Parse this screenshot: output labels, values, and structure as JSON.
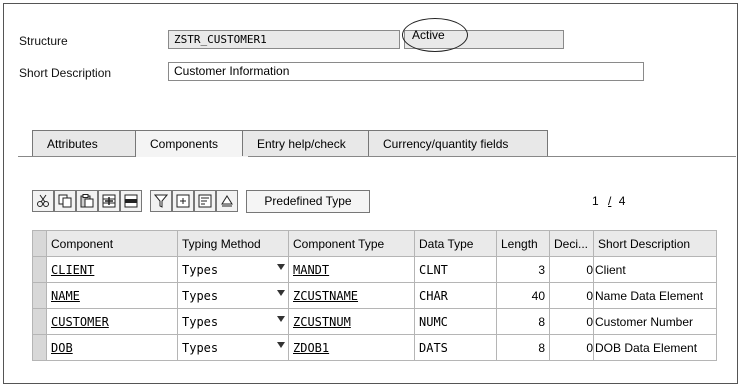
{
  "header": {
    "structure_label": "Structure",
    "structure_value": "ZSTR_CUSTOMER1",
    "status": "Active",
    "short_desc_label": "Short Description",
    "short_desc_value": "Customer Information"
  },
  "tabs": [
    {
      "label": "Attributes",
      "active": false
    },
    {
      "label": "Components",
      "active": true
    },
    {
      "label": "Entry help/check",
      "active": false
    },
    {
      "label": "Currency/quantity fields",
      "active": false
    }
  ],
  "toolbar": {
    "icons": [
      "cut-icon",
      "copy-icon",
      "paste-icon",
      "insert-row-icon",
      "delete-row-icon",
      "filter-icon",
      "append-icon",
      "sort-icon",
      "up-icon"
    ],
    "predefined_type_label": "Predefined Type",
    "pager": {
      "current": "1",
      "separator": "/",
      "total": "4"
    }
  },
  "grid": {
    "columns": [
      "Component",
      "Typing Method",
      "Component Type",
      "Data Type",
      "Length",
      "Deci...",
      "Short Description"
    ],
    "rows": [
      {
        "component": "CLIENT",
        "typing": "Types",
        "ctype": "MANDT",
        "dtype": "CLNT",
        "length": "3",
        "decimals": "0",
        "desc": "Client"
      },
      {
        "component": "NAME",
        "typing": "Types",
        "ctype": "ZCUSTNAME",
        "dtype": "CHAR",
        "length": "40",
        "decimals": "0",
        "desc": "Name Data Element"
      },
      {
        "component": "CUSTOMER",
        "typing": "Types",
        "ctype": "ZCUSTNUM",
        "dtype": "NUMC",
        "length": "8",
        "decimals": "0",
        "desc": "Customer Number"
      },
      {
        "component": "DOB",
        "typing": "Types",
        "ctype": "ZDOB1",
        "dtype": "DATS",
        "length": "8",
        "decimals": "0",
        "desc": "DOB Data Element"
      }
    ]
  }
}
